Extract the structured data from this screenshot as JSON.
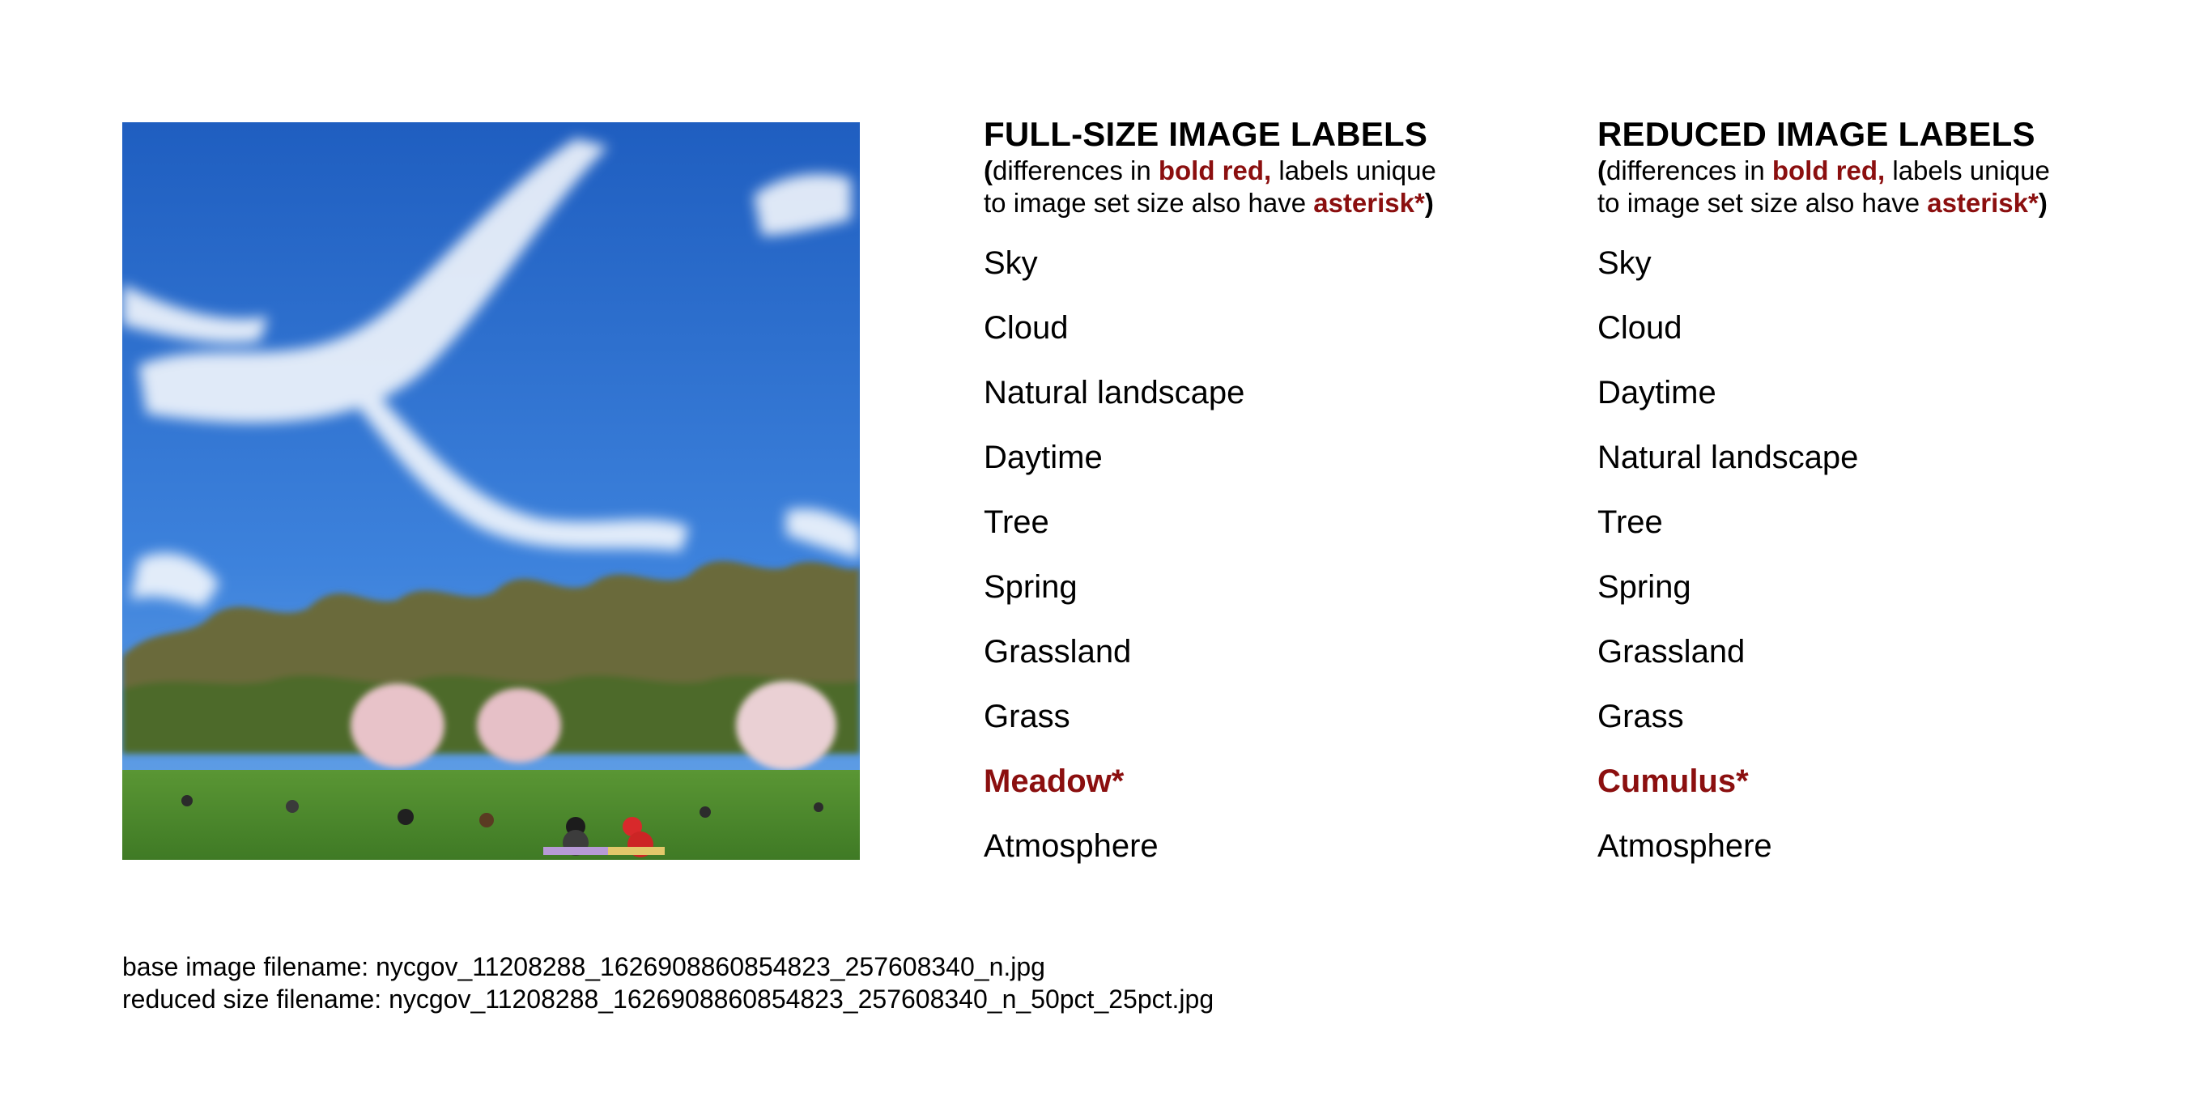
{
  "photo": {
    "alt": ""
  },
  "full": {
    "title": "FULL-SIZE IMAGE LABELS",
    "note_open": "(",
    "note_a": "differences in ",
    "note_bold_red": "bold red,",
    "note_b": " labels unique",
    "note_c": "to image set size also have ",
    "note_asterisk": "asterisk*",
    "note_close": ")",
    "labels": [
      "Sky",
      "Cloud",
      "Natural landscape",
      "Daytime",
      "Tree",
      "Spring",
      "Grassland",
      "Grass",
      "Meadow*",
      "Atmosphere"
    ],
    "diff_index": 8
  },
  "reduced": {
    "title": "REDUCED IMAGE LABELS",
    "note_open": "(",
    "note_a": "differences in ",
    "note_bold_red": "bold red,",
    "note_b": " labels unique",
    "note_c": "to image set size also have ",
    "note_asterisk": "asterisk*",
    "note_close": ")",
    "labels": [
      "Sky",
      "Cloud",
      "Daytime",
      "Natural landscape",
      "Tree",
      "Spring",
      "Grassland",
      "Grass",
      "Cumulus*",
      "Atmosphere"
    ],
    "diff_index": 8
  },
  "footer": {
    "base": "base image filename: nycgov_11208288_1626908860854823_257608340_n.jpg",
    "reduced": "reduced size filename: nycgov_11208288_1626908860854823_257608340_n_50pct_25pct.jpg"
  },
  "colors": {
    "highlight": "#8b0f0f",
    "sky_top": "#1d5fc4",
    "sky_bottom": "#5fa0e6",
    "grass": "#4f8a2c"
  }
}
